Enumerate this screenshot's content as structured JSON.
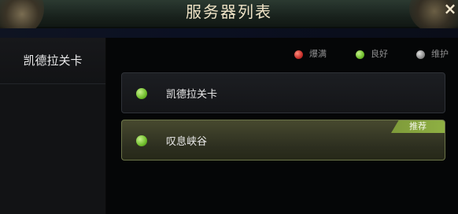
{
  "header": {
    "title": "服务器列表",
    "close_label": "×"
  },
  "sidebar": {
    "items": [
      {
        "label": "凯德拉关卡"
      }
    ]
  },
  "legend": [
    {
      "label": "爆满",
      "color": "#c7302b"
    },
    {
      "label": "良好",
      "color": "#6fbd2b"
    },
    {
      "label": "维护",
      "color": "#8d8d8d"
    }
  ],
  "servers": [
    {
      "name": "凯德拉关卡",
      "status_color": "#6fbd2b",
      "badge": ""
    },
    {
      "name": "叹息峡谷",
      "status_color": "#6fbd2b",
      "badge": "推荐"
    }
  ]
}
